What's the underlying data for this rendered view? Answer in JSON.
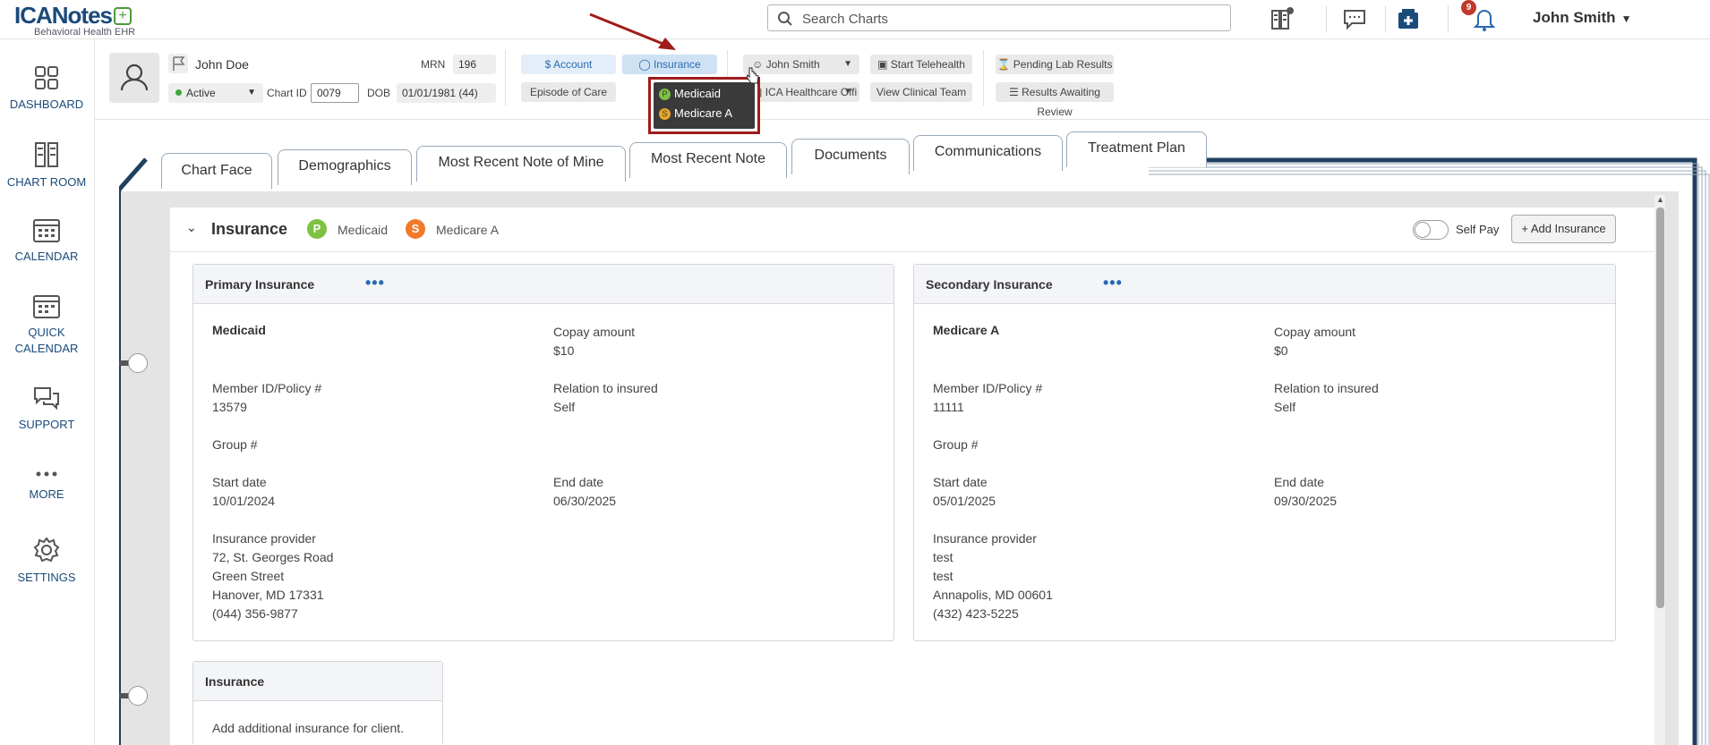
{
  "app": {
    "logo_text": "ICANotes",
    "logo_sub": "Behavioral Health EHR"
  },
  "topbar": {
    "search_placeholder": "Search Charts",
    "notification_count": "9",
    "user_name": "John Smith",
    "icons": [
      "chart-room-add-icon",
      "message-icon",
      "rx-add-icon",
      "bell-icon"
    ]
  },
  "sidebar": {
    "items": [
      {
        "label": "DASHBOARD",
        "icon": "dashboard-icon"
      },
      {
        "label": "CHART ROOM",
        "icon": "chart-room-icon"
      },
      {
        "label": "CALENDAR",
        "icon": "calendar-icon"
      },
      {
        "label": "QUICK CALENDAR",
        "label_line1": "QUICK",
        "label_line2": "CALENDAR",
        "icon": "quick-calendar-icon"
      },
      {
        "label": "SUPPORT",
        "icon": "support-icon"
      },
      {
        "label": "MORE",
        "icon": "more-icon"
      },
      {
        "label": "SETTINGS",
        "icon": "settings-icon"
      }
    ]
  },
  "patient": {
    "name": "John Doe",
    "status": "Active",
    "mrn_label": "MRN",
    "mrn": "196",
    "chart_id_label": "Chart ID",
    "chart_id": "0079",
    "dob_label": "DOB",
    "dob": "01/01/1981 (44)"
  },
  "actions": {
    "account": "Account",
    "insurance": "Insurance",
    "episode_of_care": "Episode of Care",
    "provider": "John Smith",
    "facility": "ICA Healthcare Offi",
    "start_telehealth": "Start Telehealth",
    "view_clinical_team": "View Clinical Team",
    "pending_lab_results": "Pending Lab Results",
    "results_awaiting_review": "Results Awaiting Review"
  },
  "insurance_dropdown": {
    "items": [
      {
        "badge": "P",
        "label": "Medicaid",
        "color": "#7dc242"
      },
      {
        "badge": "S",
        "label": "Medicare A",
        "color": "#e8a524"
      }
    ]
  },
  "tabs": [
    "Chart Face",
    "Demographics",
    "Most Recent Note of Mine",
    "Most Recent Note",
    "Documents",
    "Communications",
    "Treatment Plan"
  ],
  "insurance_section": {
    "title": "Insurance",
    "primary_badge": "P",
    "primary_name": "Medicaid",
    "primary_color": "#7dc242",
    "secondary_badge": "S",
    "secondary_name": "Medicare A",
    "secondary_color": "#f07a2a",
    "self_pay_label": "Self Pay",
    "add_insurance_label": "+ Add Insurance"
  },
  "primary": {
    "header": "Primary Insurance",
    "name": "Medicaid",
    "copay_label": "Copay amount",
    "copay": "$10",
    "member_id_label": "Member ID/Policy #",
    "member_id": "13579",
    "relation_label": "Relation to insured",
    "relation": "Self",
    "group_label": "Group #",
    "start_label": "Start date",
    "start": "10/01/2024",
    "end_label": "End date",
    "end": "06/30/2025",
    "provider_label": "Insurance provider",
    "provider_line1": "72, St. Georges Road",
    "provider_line2": "Green Street",
    "provider_line3": "Hanover, MD 17331",
    "provider_phone": "(044) 356-9877"
  },
  "secondary": {
    "header": "Secondary Insurance",
    "name": "Medicare A",
    "copay_label": "Copay amount",
    "copay": "$0",
    "member_id_label": "Member ID/Policy #",
    "member_id": "11111",
    "relation_label": "Relation to insured",
    "relation": "Self",
    "group_label": "Group #",
    "start_label": "Start date",
    "start": "05/01/2025",
    "end_label": "End date",
    "end": "09/30/2025",
    "provider_label": "Insurance provider",
    "provider_line1": "test",
    "provider_line2": "test",
    "provider_line3": "Annapolis, MD 00601",
    "provider_phone": "(432) 423-5225"
  },
  "additional": {
    "header": "Insurance",
    "text": "Add additional insurance for client."
  }
}
